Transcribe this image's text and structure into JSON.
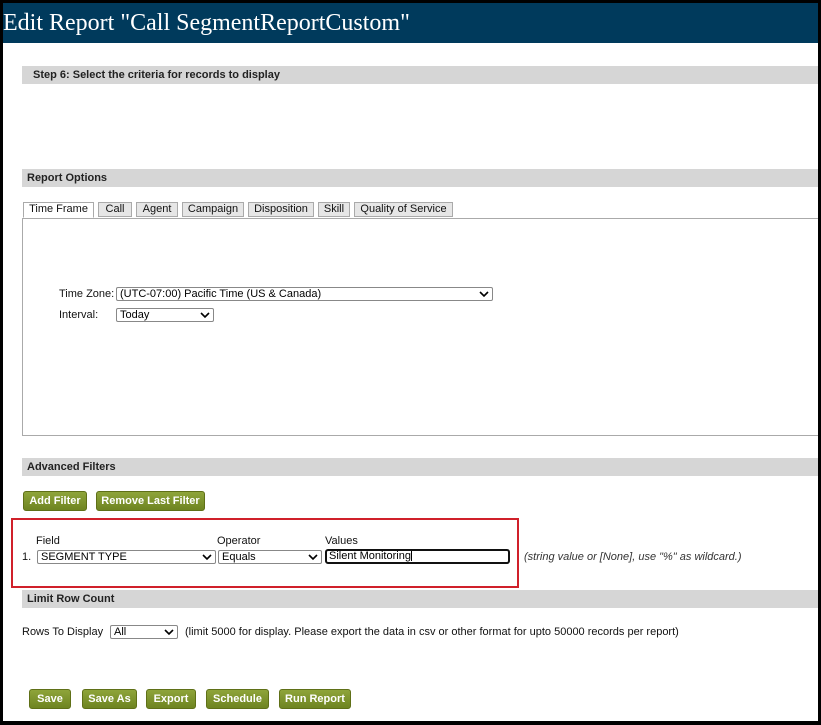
{
  "header": {
    "title": "Edit Report \"Call SegmentReportCustom\""
  },
  "step": {
    "label": "Step 6: Select the criteria for records to display"
  },
  "report_options": {
    "title": "Report Options",
    "tabs": [
      "Time Frame",
      "Call",
      "Agent",
      "Campaign",
      "Disposition",
      "Skill",
      "Quality of Service"
    ],
    "active_tab": "Time Frame",
    "time_zone_label": "Time Zone:",
    "time_zone_value": "(UTC-07:00) Pacific Time (US & Canada)",
    "interval_label": "Interval:",
    "interval_value": "Today"
  },
  "advanced_filters": {
    "title": "Advanced Filters",
    "add_filter_label": "Add Filter",
    "remove_last_filter_label": "Remove Last Filter",
    "field_header": "Field",
    "operator_header": "Operator",
    "values_header": "Values",
    "row_number": "1.",
    "field_value": "SEGMENT TYPE",
    "operator_value": "Equals",
    "values_value": "Silent Monitoring",
    "hint": "(string value or [None], use \"%\" as wildcard.)"
  },
  "limit_row_count": {
    "title": "Limit Row Count",
    "rows_label": "Rows To Display",
    "rows_value": "All",
    "note": "(limit 5000 for display. Please export the data in csv or other format for upto 50000 records per report)"
  },
  "actions": {
    "save": "Save",
    "save_as": "Save As",
    "export": "Export",
    "schedule": "Schedule",
    "run_report": "Run Report"
  },
  "colors": {
    "title_bar": "#003a5c",
    "section_bar": "#d6d6d6",
    "button": "#7a9128",
    "highlight_box": "#d0202a"
  }
}
